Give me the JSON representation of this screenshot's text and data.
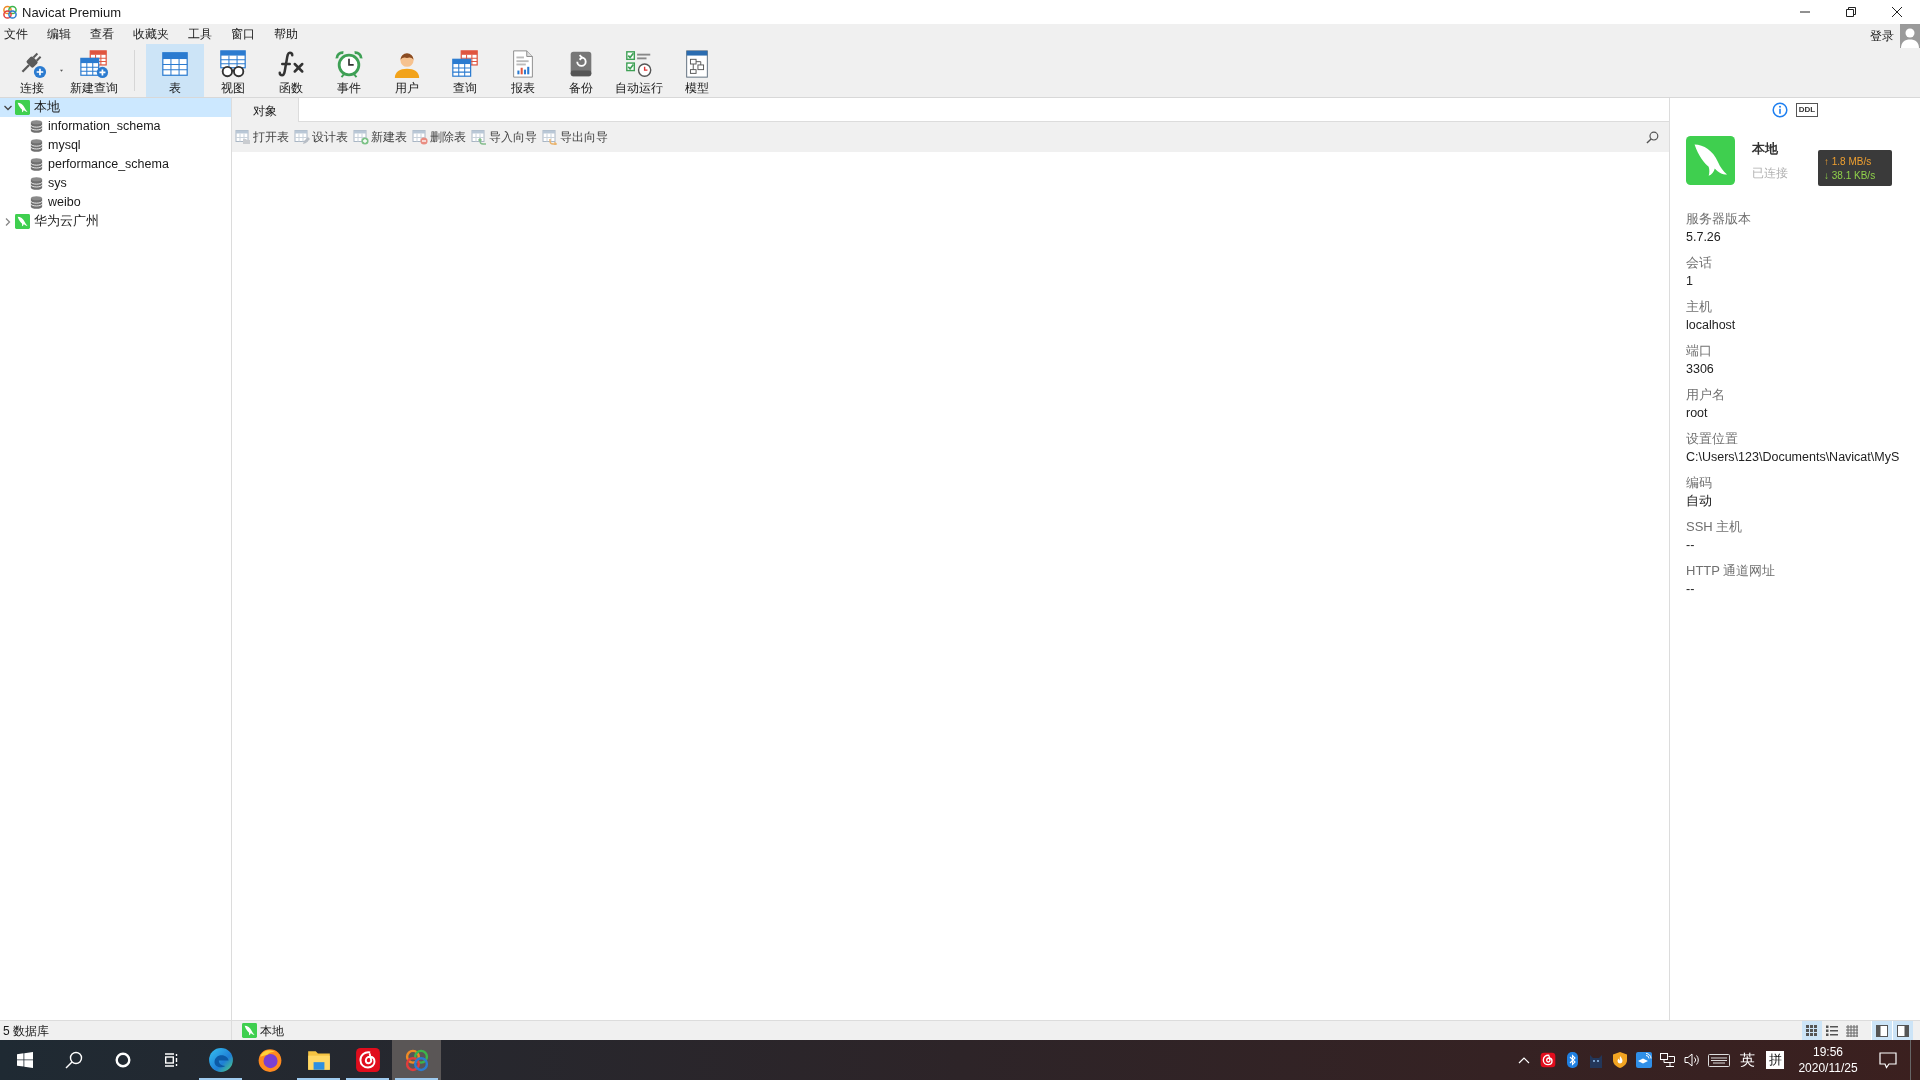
{
  "window": {
    "title": "Navicat Premium"
  },
  "menu": [
    "文件",
    "编辑",
    "查看",
    "收藏夹",
    "工具",
    "窗口",
    "帮助"
  ],
  "account": {
    "label": "登录"
  },
  "toolbar": {
    "actions": [
      {
        "label": "连接",
        "dropdown": true
      },
      {
        "label": "新建查询",
        "dropdown": false
      }
    ],
    "objects": [
      {
        "label": "表",
        "selected": true
      },
      {
        "label": "视图",
        "selected": false
      },
      {
        "label": "函数",
        "selected": false
      },
      {
        "label": "事件",
        "selected": false
      },
      {
        "label": "用户",
        "selected": false
      },
      {
        "label": "查询",
        "selected": false
      },
      {
        "label": "报表",
        "selected": false
      },
      {
        "label": "备份",
        "selected": false
      },
      {
        "label": "自动运行",
        "selected": false
      },
      {
        "label": "模型",
        "selected": false
      }
    ]
  },
  "navigator": {
    "connections": [
      {
        "name": "本地",
        "expanded": true,
        "selected": true,
        "children": [
          {
            "name": "information_schema",
            "selected": false
          },
          {
            "name": "mysql",
            "selected": false
          },
          {
            "name": "performance_schema",
            "selected": false
          },
          {
            "name": "sys",
            "selected": false
          },
          {
            "name": "weibo",
            "selected": false
          }
        ]
      },
      {
        "name": "华为云广州",
        "expanded": false,
        "selected": false
      }
    ]
  },
  "object_tabs": [
    {
      "label": "对象",
      "selected": true
    }
  ],
  "object_toolbar": [
    "打开表",
    "设计表",
    "新建表",
    "删除表",
    "导入向导",
    "导出向导"
  ],
  "info_panel": {
    "tabs": [
      {
        "selected": true
      },
      {
        "label": "DDL",
        "selected": false
      }
    ],
    "connection": {
      "name": "本地",
      "status": "已连接"
    },
    "traffic": [
      {
        "text": "↑ 1.8 MB/s",
        "color": "#f0a030"
      },
      {
        "text": "↓ 38.1 KB/s",
        "color": "#8fd14a"
      }
    ],
    "properties": [
      {
        "label": "服务器版本",
        "value": "5.7.26"
      },
      {
        "label": "会话",
        "value": "1"
      },
      {
        "label": "主机",
        "value": "localhost"
      },
      {
        "label": "端口",
        "value": "3306"
      },
      {
        "label": "用户名",
        "value": "root"
      },
      {
        "label": "设置位置",
        "value": "C:\\Users\\123\\Documents\\Navicat\\MyS"
      },
      {
        "label": "编码",
        "value": "自动"
      },
      {
        "label": "SSH 主机",
        "value": "--"
      },
      {
        "label": "HTTP 通道网址",
        "value": "--"
      }
    ]
  },
  "status_bar": {
    "count": "5 数据库",
    "connection": "本地",
    "views": [
      {
        "selected": true
      },
      {
        "selected": false
      },
      {
        "selected": false
      }
    ],
    "panels": [
      {
        "on": true
      },
      {
        "on": true
      }
    ]
  },
  "taskbar": {
    "apps": [
      {
        "running": true,
        "active": false
      },
      {
        "running": false,
        "active": false
      },
      {
        "running": true,
        "active": false
      },
      {
        "running": true,
        "active": false
      },
      {
        "running": true,
        "active": true
      }
    ],
    "tray": {
      "input_language": "英",
      "input_mode": "拼",
      "time": "19:56",
      "date": "2020/11/25"
    }
  }
}
